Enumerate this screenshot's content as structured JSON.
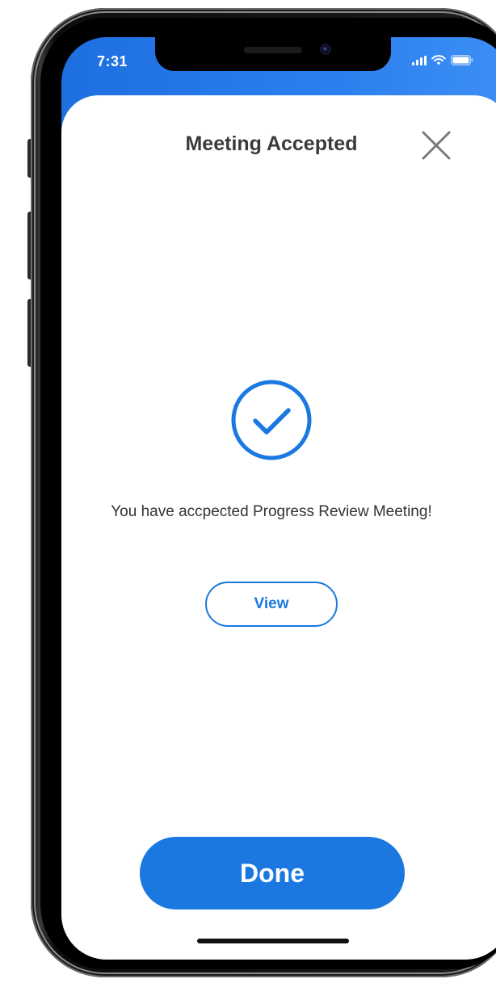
{
  "status_bar": {
    "time": "7:31"
  },
  "modal": {
    "title": "Meeting Accepted",
    "message": "You have accpected Progress Review Meeting!",
    "view_label": "View",
    "done_label": "Done"
  },
  "icons": {
    "close": "close-icon",
    "success": "checkmark-circle-icon",
    "signal": "cellular-signal-icon",
    "wifi": "wifi-icon",
    "battery": "battery-icon"
  },
  "colors": {
    "accent": "#1a78e0",
    "header_gradient_start": "#1e6fe0",
    "header_gradient_end": "#3d8ff5",
    "title_text": "#3a3a3a",
    "body_text": "#333333",
    "close_icon": "#7a7a7a"
  }
}
